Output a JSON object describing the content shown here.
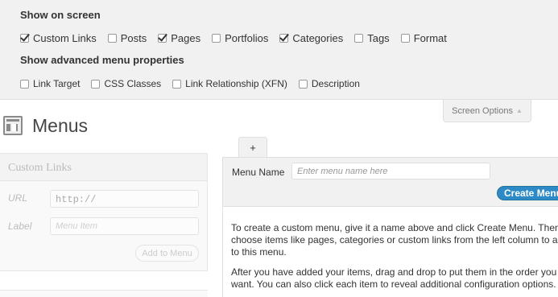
{
  "screen_options": {
    "show_on_screen_heading": "Show on screen",
    "show_on_screen": [
      {
        "label": "Custom Links",
        "checked": true
      },
      {
        "label": "Posts",
        "checked": false
      },
      {
        "label": "Pages",
        "checked": true
      },
      {
        "label": "Portfolios",
        "checked": false
      },
      {
        "label": "Categories",
        "checked": true
      },
      {
        "label": "Tags",
        "checked": false
      },
      {
        "label": "Format",
        "checked": false
      }
    ],
    "advanced_heading": "Show advanced menu properties",
    "advanced": [
      {
        "label": "Link Target",
        "checked": false
      },
      {
        "label": "CSS Classes",
        "checked": false
      },
      {
        "label": "Link Relationship (XFN)",
        "checked": false
      },
      {
        "label": "Description",
        "checked": false
      }
    ],
    "tab_label": "Screen Options",
    "tab_arrow": "▲"
  },
  "page": {
    "title": "Menus"
  },
  "custom_links": {
    "header": "Custom Links",
    "url_label": "URL",
    "url_value": "http://",
    "label_label": "Label",
    "label_placeholder": "Menu Item",
    "add_button": "Add to Menu"
  },
  "menu_editor": {
    "tab_label": "+",
    "menu_name_label": "Menu Name",
    "menu_name_placeholder": "Enter menu name here",
    "create_button": "Create Menu",
    "instructions_1": "To create a custom menu, give it a name above and click Create Menu. Then choose items like pages, categories or custom links from the left column to add to this menu.",
    "instructions_2": "After you have added your items, drag and drop to put them in the order you want. You can also click each item to reveal additional configuration options."
  }
}
